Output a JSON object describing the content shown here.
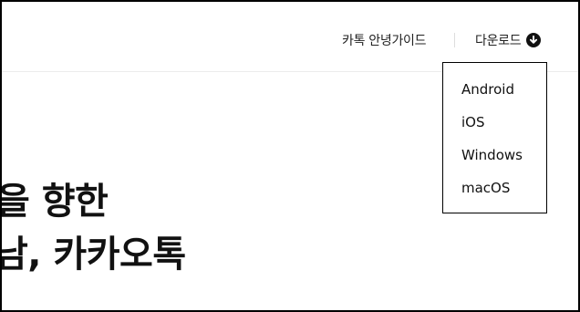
{
  "header": {
    "nav_guide_label": "카톡 안녕가이드",
    "download_label": "다운로드",
    "download_icon": "arrow-down-circle-icon"
  },
  "download_menu": {
    "items": [
      {
        "label": "Android"
      },
      {
        "label": "iOS"
      },
      {
        "label": "Windows"
      },
      {
        "label": "macOS"
      }
    ]
  },
  "hero": {
    "line1": "을 향한",
    "line2": "남, 카카오톡"
  },
  "colors": {
    "text": "#111111",
    "frame_border": "#000000",
    "divider": "#dddddd"
  }
}
